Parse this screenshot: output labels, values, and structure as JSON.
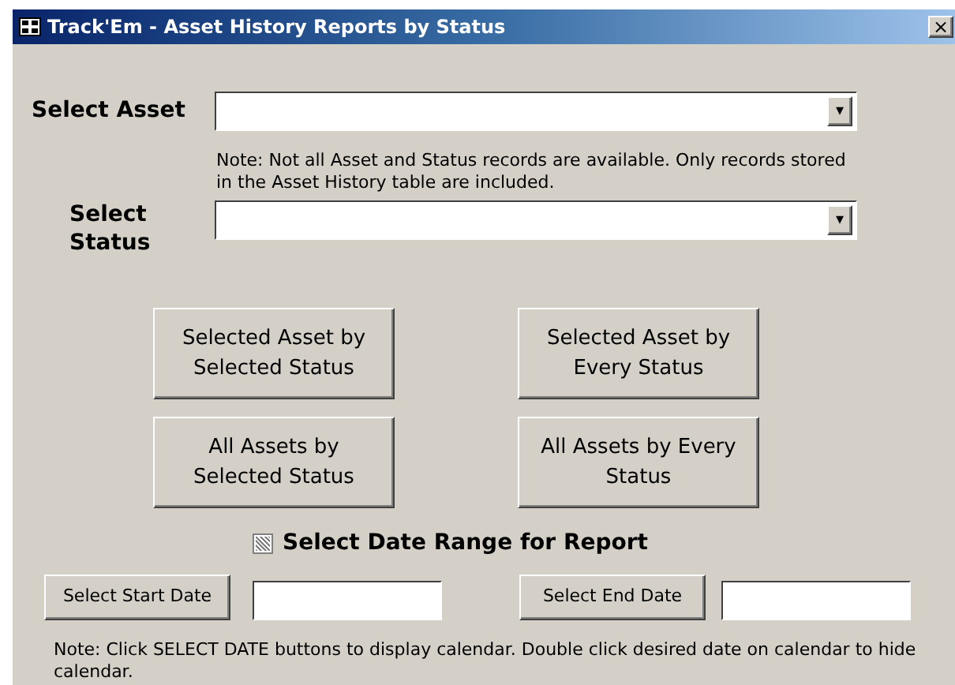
{
  "window": {
    "title": "Track'Em - Asset History Reports by Status",
    "close": "×"
  },
  "asset": {
    "label": "Select Asset",
    "arrow": "▾"
  },
  "note_1": "Note: Not all Asset and Status records are available.  Only records stored in the Asset History table are included.",
  "status": {
    "label": "Select Status",
    "arrow": "▾"
  },
  "report_buttons": [
    {
      "label": "Selected Asset by Selected Status"
    },
    {
      "label": "Selected Asset by Every Status"
    },
    {
      "label": "All Assets by Selected Status"
    },
    {
      "label": "All Assets by Every Status"
    }
  ],
  "date_range": {
    "label": "Select Date Range for Report",
    "indeterminate": true
  },
  "start_date": {
    "button": "Select Start Date"
  },
  "end_date": {
    "button": "Select End Date"
  },
  "note_2": "Note: Click SELECT DATE buttons to display calendar.  Double click desired date on calendar to hide calendar."
}
